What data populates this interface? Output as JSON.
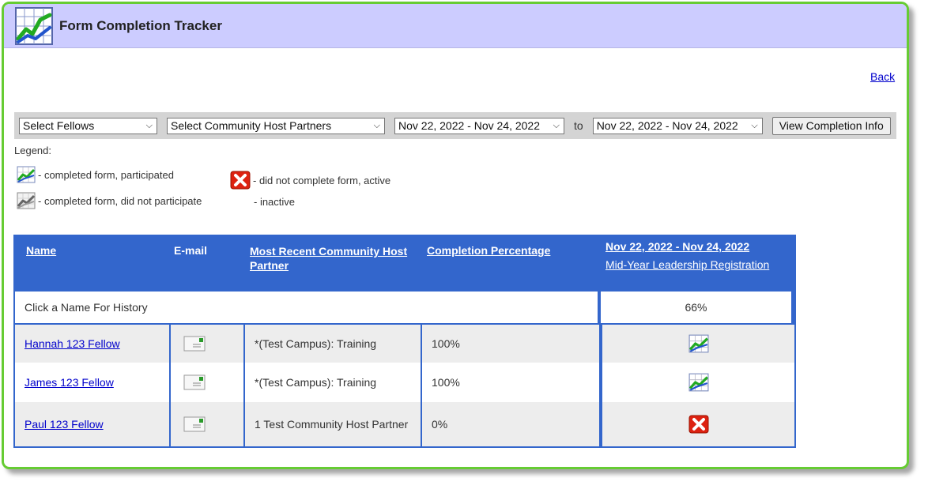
{
  "app": {
    "title": "Form Completion Tracker"
  },
  "nav": {
    "back": "Back"
  },
  "filters": {
    "fellows": "Select Fellows",
    "partners": "Select Community Host Partners",
    "date_from": "Nov 22, 2022 - Nov 24, 2022",
    "to_label": "to",
    "date_to": "Nov 22, 2022 - Nov 24, 2022",
    "view_button": "View Completion Info"
  },
  "legend": {
    "title": "Legend:",
    "completed_participated": "- completed form, participated",
    "completed_not_participated": "- completed form, did not participate",
    "not_completed_active": "- did not complete form, active",
    "inactive": "- inactive"
  },
  "table": {
    "headers": {
      "name": "Name",
      "email": "E-mail",
      "partner": "Most Recent Community Host Partner",
      "completion": "Completion Percentage",
      "period": "Nov 22, 2022 - Nov 24, 2022",
      "form": "Mid-Year Leadership Registration"
    },
    "summary": {
      "label": "Click a Name For History",
      "percent": "66%"
    },
    "rows": [
      {
        "name": "Hannah 123 Fellow",
        "partner": "*(Test Campus): Training",
        "completion": "100%",
        "status": "completed"
      },
      {
        "name": "James 123 Fellow",
        "partner": "*(Test Campus): Training",
        "completion": "100%",
        "status": "completed"
      },
      {
        "name": "Paul 123 Fellow",
        "partner": "1 Test Community Host Partner",
        "completion": "0%",
        "status": "not-completed"
      }
    ]
  },
  "colors": {
    "titlebar": "#ccccff",
    "frame": "#66cc33",
    "table_header": "#3366cc",
    "row_alt": "#ededed",
    "link": "#0000cc",
    "error": "#dd2211"
  }
}
